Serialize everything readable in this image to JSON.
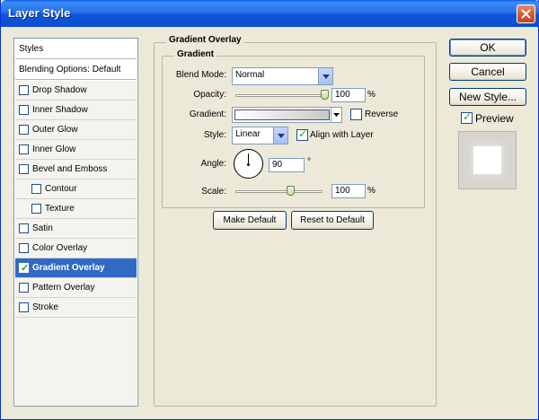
{
  "window": {
    "title": "Layer Style"
  },
  "styles_list": {
    "header": "Styles",
    "blending": "Blending Options: Default",
    "items": [
      {
        "label": "Drop Shadow",
        "checked": false,
        "indent": false
      },
      {
        "label": "Inner Shadow",
        "checked": false,
        "indent": false
      },
      {
        "label": "Outer Glow",
        "checked": false,
        "indent": false
      },
      {
        "label": "Inner Glow",
        "checked": false,
        "indent": false
      },
      {
        "label": "Bevel and Emboss",
        "checked": false,
        "indent": false
      },
      {
        "label": "Contour",
        "checked": false,
        "indent": true
      },
      {
        "label": "Texture",
        "checked": false,
        "indent": true
      },
      {
        "label": "Satin",
        "checked": false,
        "indent": false
      },
      {
        "label": "Color Overlay",
        "checked": false,
        "indent": false
      },
      {
        "label": "Gradient Overlay",
        "checked": true,
        "indent": false,
        "selected": true
      },
      {
        "label": "Pattern Overlay",
        "checked": false,
        "indent": false
      },
      {
        "label": "Stroke",
        "checked": false,
        "indent": false
      }
    ]
  },
  "panel": {
    "title": "Gradient Overlay",
    "group_title": "Gradient",
    "blend_mode": {
      "label": "Blend Mode:",
      "value": "Normal"
    },
    "opacity": {
      "label": "Opacity:",
      "value": "100",
      "unit": "%",
      "level": 1.0
    },
    "gradient": {
      "label": "Gradient:",
      "reverse_label": "Reverse",
      "reverse_checked": false
    },
    "style": {
      "label": "Style:",
      "value": "Linear",
      "align_label": "Align with Layer",
      "align_checked": true
    },
    "angle": {
      "label": "Angle:",
      "value": "90",
      "unit": "°"
    },
    "scale": {
      "label": "Scale:",
      "value": "100",
      "unit": "%",
      "level": 0.4
    },
    "make_default": "Make Default",
    "reset_default": "Reset to Default"
  },
  "actions": {
    "ok": "OK",
    "cancel": "Cancel",
    "new_style": "New Style...",
    "preview_label": "Preview",
    "preview_checked": true
  }
}
